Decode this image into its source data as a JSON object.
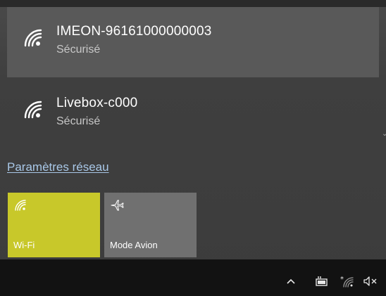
{
  "networks": [
    {
      "name": "IMEON-96161000000003",
      "status": "Sécurisé",
      "icon": "wifi-icon",
      "highlighted": true
    },
    {
      "name": "Livebox-c000",
      "status": "Sécurisé",
      "icon": "wifi-icon",
      "highlighted": false
    }
  ],
  "network_settings_link": "Paramètres réseau",
  "quick_actions": [
    {
      "label": "Wi-Fi",
      "icon": "wifi-icon",
      "active": true,
      "color": "#c8c82a"
    },
    {
      "label": "Mode Avion",
      "icon": "airplane-icon",
      "active": false,
      "color": "#707070"
    }
  ],
  "tray_icons": [
    "chevron-up-icon",
    "battery-icon",
    "wifi-icon",
    "volume-muted-icon"
  ],
  "colors": {
    "accent": "#c8c82a",
    "link": "#a9c8e8",
    "taskbar": "#121212"
  }
}
